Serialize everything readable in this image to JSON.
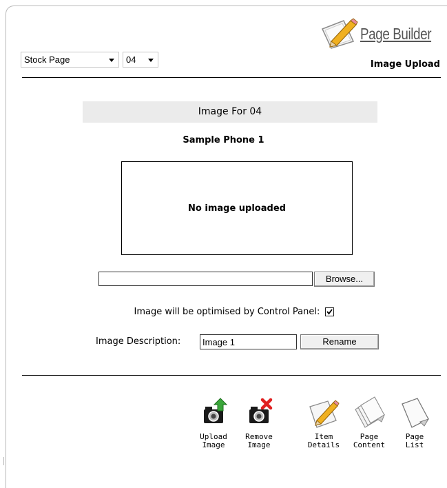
{
  "header": {
    "brand_title": "Page Builder",
    "section_title": "Image Upload",
    "page_select": {
      "value": "Stock Page"
    },
    "number_select": {
      "value": "04"
    }
  },
  "main": {
    "image_for": "Image For 04",
    "item_name": "Sample Phone 1",
    "image_placeholder": "No image uploaded",
    "browse_label": "Browse...",
    "optimise_label": "Image will be optimised by Control Panel:",
    "optimise_checked": true,
    "description_label": "Image Description:",
    "description_value": "Image 1",
    "rename_label": "Rename"
  },
  "toolbar": {
    "upload_label": "Upload\nImage",
    "remove_label": "Remove\nImage",
    "item_details_label": "Item\nDetails",
    "page_content_label": "Page\nContent",
    "page_list_label": "Page\nList"
  },
  "icons": {
    "brand": "pencil-page-icon",
    "upload": "camera-upload-icon",
    "remove": "camera-remove-icon",
    "item_details": "pencil-page-icon",
    "page_content": "stacked-pages-icon",
    "page_list": "page-icon"
  },
  "colors": {
    "upload_arrow": "#3aa63a",
    "remove_cross": "#e02020",
    "pencil": "#f0b020",
    "title_bar": "#ebebeb"
  }
}
